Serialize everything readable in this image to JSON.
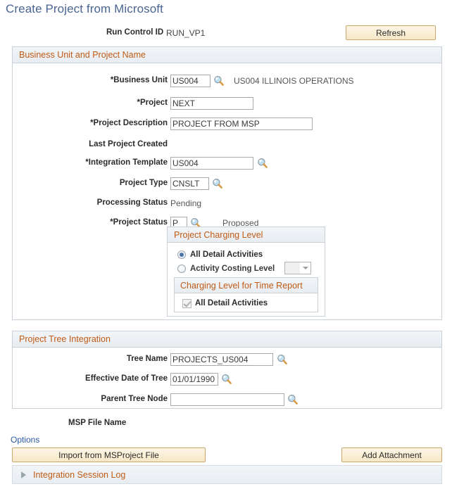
{
  "page": {
    "title": "Create Project from Microsoft"
  },
  "run_control": {
    "label": "Run Control ID",
    "value": "RUN_VP1"
  },
  "toolbar": {
    "refresh_label": "Refresh"
  },
  "business_unit_section": {
    "header": "Business Unit and Project Name",
    "fields": {
      "business_unit": {
        "label": "*Business Unit",
        "value": "US004",
        "description": "US004 ILLINOIS OPERATIONS",
        "lookup_icon": "magnifier-icon"
      },
      "project": {
        "label": "*Project",
        "value": "NEXT"
      },
      "project_description": {
        "label": "*Project Description",
        "value": "PROJECT FROM MSP"
      },
      "last_project_created": {
        "label": "Last Project Created",
        "value": ""
      },
      "integration_template": {
        "label": "*Integration Template",
        "value": "US004",
        "lookup_icon": "magnifier-icon"
      },
      "project_type": {
        "label": "Project Type",
        "value": "CNSLT",
        "lookup_icon": "magnifier-icon"
      },
      "processing_status": {
        "label": "Processing Status",
        "value": "Pending"
      },
      "project_status": {
        "label": "*Project Status",
        "value": "P",
        "description": "Proposed",
        "lookup_icon": "magnifier-icon"
      }
    }
  },
  "charging_level_panel": {
    "header": "Project Charging Level",
    "radio_all_detail": {
      "label": "All Detail Activities",
      "selected": true
    },
    "radio_activity_costing": {
      "label": "Activity Costing Level",
      "selected": false
    },
    "costing_level_select": {
      "value": "",
      "arrow_icon": "chevron-down-icon"
    },
    "time_report_panel": {
      "header": "Charging Level for Time Report",
      "checkbox": {
        "label": "All Detail Activities",
        "checked": true
      }
    }
  },
  "tree_section": {
    "header": "Project Tree Integration",
    "fields": {
      "tree_name": {
        "label": "Tree Name",
        "value": "PROJECTS_US004",
        "lookup_icon": "magnifier-icon"
      },
      "effective_date": {
        "label": "Effective Date of Tree",
        "value": "01/01/1990",
        "lookup_icon": "calendar-lookup-icon"
      },
      "parent_tree_node": {
        "label": "Parent Tree Node",
        "value": "",
        "lookup_icon": "magnifier-icon"
      }
    }
  },
  "footer": {
    "msp_file_name_label": "MSP File Name",
    "msp_file_name_value": "",
    "options_label": "Options",
    "import_button": "Import from MSProject File",
    "attach_button": "Add Attachment",
    "session_log_label": "Integration Session Log",
    "session_log_expanded": false
  },
  "colors": {
    "title_blue": "#4a6593",
    "section_header_text": "#c05b16",
    "section_header_bg": "#eef2f6",
    "button_bg": "#f7e7c6",
    "button_border": "#c8a96b",
    "link_blue": "#2b5b9e",
    "radio_dot": "#4a74a8"
  }
}
